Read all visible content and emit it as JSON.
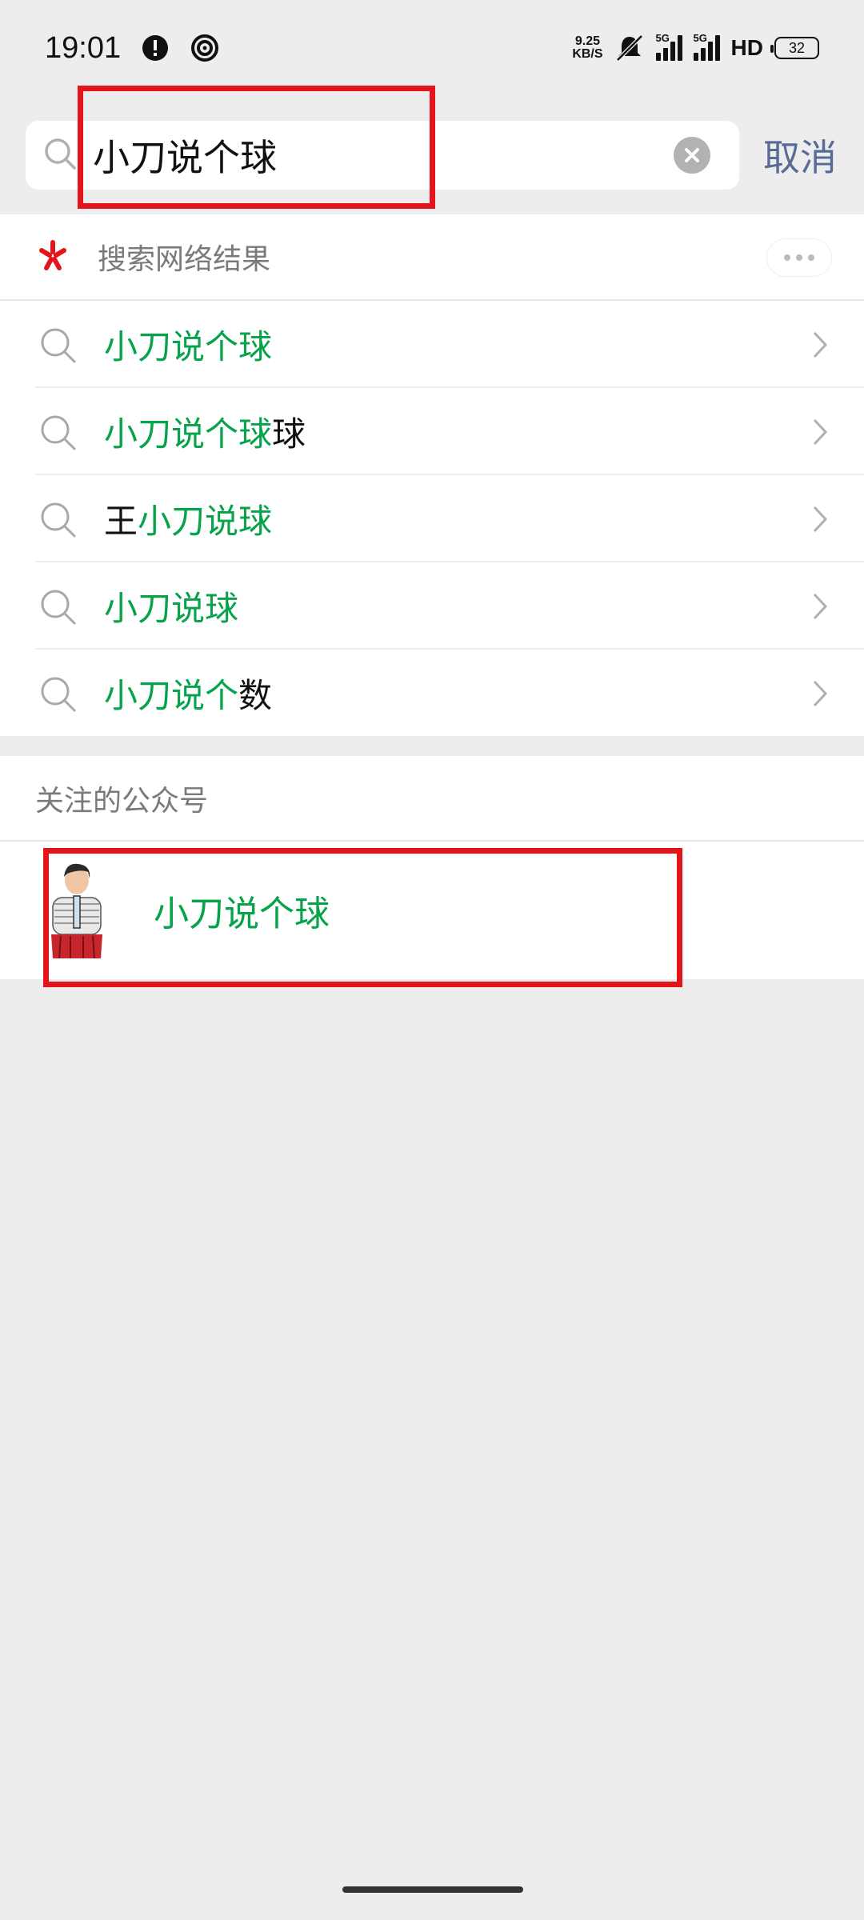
{
  "status_bar": {
    "time": "19:01",
    "net_speed_value": "9.25",
    "net_speed_unit": "KB/S",
    "signal_tag_1": "5G",
    "signal_tag_2": "5G",
    "hd_label": "HD",
    "battery": "32"
  },
  "search": {
    "query": "小刀说个球",
    "cancel_label": "取消"
  },
  "web_results": {
    "header_label": "搜索网络结果",
    "suggestions": [
      {
        "green": "小刀说个球",
        "rest": ""
      },
      {
        "green": "小刀说个球",
        "rest": "球"
      },
      {
        "prefix": "王",
        "green": "小刀说球",
        "rest": ""
      },
      {
        "green": "小刀说球",
        "rest": ""
      },
      {
        "green": "小刀说个",
        "rest": "数"
      }
    ]
  },
  "followed_accounts": {
    "header_label": "关注的公众号",
    "items": [
      {
        "name": "小刀说个球"
      }
    ]
  },
  "colors": {
    "accent_green": "#07a34b",
    "link_blue": "#576b95",
    "highlight_red": "#e5141b",
    "background": "#ededed"
  }
}
